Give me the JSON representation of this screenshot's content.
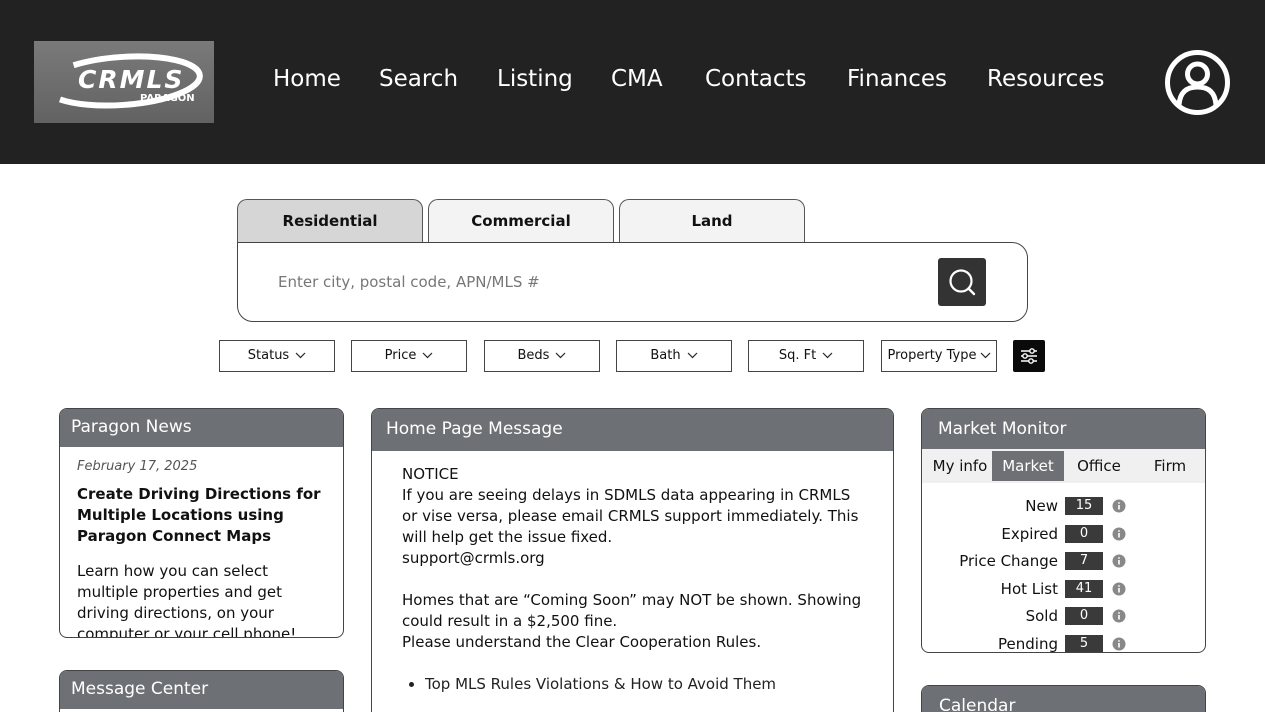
{
  "header": {
    "logo_text": "CRMLS",
    "logo_sub": "PARAGON",
    "nav": [
      {
        "label": "Home"
      },
      {
        "label": "Search"
      },
      {
        "label": "Listing"
      },
      {
        "label": "CMA"
      },
      {
        "label": "Contacts"
      },
      {
        "label": "Finances"
      },
      {
        "label": "Resources"
      }
    ],
    "avatar_icon": "user-circle-icon"
  },
  "search": {
    "tabs": [
      {
        "label": "Residential",
        "active": true
      },
      {
        "label": "Commercial",
        "active": false
      },
      {
        "label": "Land",
        "active": false
      }
    ],
    "placeholder": "Enter city, postal code, APN/MLS #",
    "button_icon": "search-icon"
  },
  "filters": [
    {
      "label": "Status"
    },
    {
      "label": "Price"
    },
    {
      "label": "Beds"
    },
    {
      "label": "Bath"
    },
    {
      "label": "Sq. Ft"
    },
    {
      "label": "Property Type"
    }
  ],
  "filters_advanced_icon": "sliders-icon",
  "news": {
    "title": "Paragon News",
    "date": "February 17, 2025",
    "headline": "Create Driving Directions for Multiple Locations using Paragon Connect Maps",
    "body": "Learn how you can select multiple properties and get driving directions, on your computer or your cell phone!"
  },
  "message_center": {
    "title": "Message Center"
  },
  "home_message": {
    "title": "Home Page Message",
    "notice": "NOTICE",
    "paragraph1": "If you are seeing delays in SDMLS data appearing in CRMLS or vise versa, please email CRMLS support immediately. This will help get the issue fixed.",
    "email": "support@crmls.org",
    "paragraph2": "Homes that are “Coming Soon” may NOT be shown. Showing could result in a $2,500 fine.",
    "paragraph3": "Please understand the Clear Cooperation Rules.",
    "bullets": [
      "Top MLS Rules Violations & How to Avoid Them"
    ]
  },
  "market_monitor": {
    "title": "Market Monitor",
    "tabs": [
      {
        "label": "My info",
        "active": false
      },
      {
        "label": "Market",
        "active": true
      },
      {
        "label": "Office",
        "active": false
      },
      {
        "label": "Firm",
        "active": false
      }
    ],
    "rows": [
      {
        "label": "New",
        "count": "15"
      },
      {
        "label": "Expired",
        "count": "0"
      },
      {
        "label": "Price Change",
        "count": "7"
      },
      {
        "label": "Hot List",
        "count": "41"
      },
      {
        "label": "Sold",
        "count": "0"
      },
      {
        "label": "Pending",
        "count": "5"
      }
    ]
  },
  "calendar": {
    "title": "Calendar"
  },
  "colors": {
    "header_bg": "#222222",
    "panel_header": "#6d7074",
    "active_tab": "#d6d6d6"
  }
}
